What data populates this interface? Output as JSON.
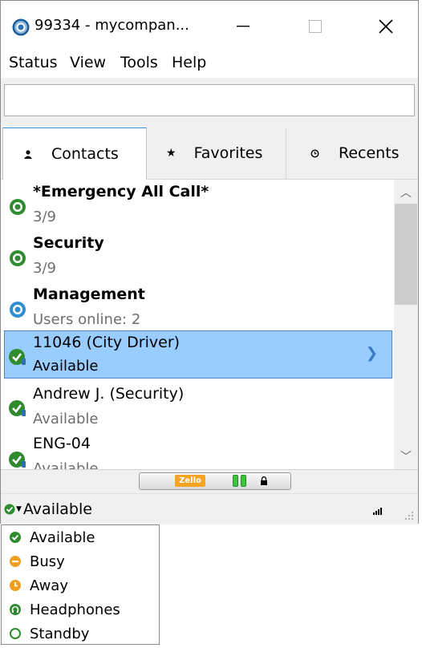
{
  "window": {
    "title": "99334 - mycompan...",
    "controls": {
      "minimize": "—",
      "maximize": "☐",
      "close": "✕"
    }
  },
  "menu": [
    "Status",
    "View",
    "Tools",
    "Help"
  ],
  "search": {
    "value": "",
    "placeholder": ""
  },
  "tabs": [
    {
      "label": "Contacts",
      "icon": "person-icon",
      "glyph": "👤",
      "active": true
    },
    {
      "label": "Favorites",
      "icon": "star-icon",
      "glyph": "★",
      "active": false
    },
    {
      "label": "Recents",
      "icon": "clock-icon",
      "glyph": "◷",
      "active": false
    }
  ],
  "contacts": [
    {
      "name": "*Emergency All Call*",
      "sub": "3/9",
      "type": "channel",
      "status_color": "#2e8b2e"
    },
    {
      "name": "Security",
      "sub": "3/9",
      "type": "channel",
      "status_color": "#2e8b2e"
    },
    {
      "name": "Management",
      "sub": "Users online: 2",
      "type": "channel",
      "status_color": "#2f8fd0"
    },
    {
      "name": "11046 (City Driver)",
      "sub": "Available",
      "type": "user",
      "status_color": "#2e8b2e",
      "selected": true
    },
    {
      "name": "Andrew J. (Security)",
      "sub": "Available",
      "type": "user",
      "status_color": "#2e8b2e"
    },
    {
      "name": "ENG-04",
      "sub": "Available",
      "type": "user",
      "status_color": "#2e8b2e"
    }
  ],
  "ptt": {
    "logo": "Zello",
    "lock_icon": "lock-icon"
  },
  "statusbar": {
    "current_status": "Available",
    "status_color": "#2e8b2e"
  },
  "status_options": [
    {
      "label": "Available",
      "color": "#2e8b2e",
      "icon": "check-icon"
    },
    {
      "label": "Busy",
      "color": "#f0a020",
      "icon": "minus-icon"
    },
    {
      "label": "Away",
      "color": "#f0a020",
      "icon": "clock-icon"
    },
    {
      "label": "Headphones",
      "color": "#2e8b2e",
      "icon": "headphones-icon"
    },
    {
      "label": "Standby",
      "color": "#2e8b2e",
      "icon": "ring-icon"
    }
  ]
}
